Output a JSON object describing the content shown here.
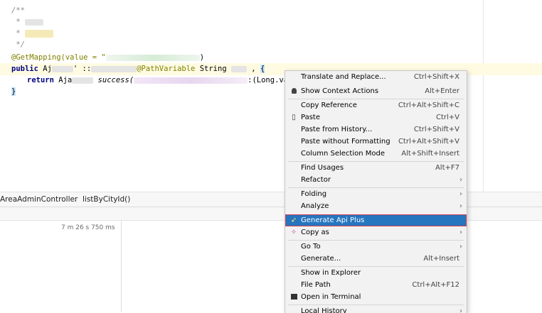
{
  "editor": {
    "comment_open": "/**",
    "comment_star1": " * ",
    "comment_star2": " * ",
    "comment_close": " */",
    "annotation_prefix": "@GetMapping(value = \"",
    "annotation_suffix": ")",
    "sig_public": "public",
    "sig_type": " Aj",
    "sig_colon": "' ::",
    "sig_pathvar": "@PathVariable",
    "sig_string": " String ",
    "sig_paren": " ,",
    "sig_brace": "{",
    "return_kw": "return",
    "return_type": " Aja",
    "return_success": " success(",
    "return_long": ":(Long.va",
    "closing_brace": "}"
  },
  "breadcrumb": {
    "class_name": "AreaAdminController",
    "separator": "›",
    "method_name": "listByCityId()"
  },
  "bottom_panel": {
    "timing": "7 m 26 s 750 ms"
  },
  "context_menu": {
    "items": [
      {
        "label": "Translate and Replace...",
        "shortcut": "Ctrl+Shift+X",
        "icon": ""
      },
      {
        "label": "Show Context Actions",
        "shortcut": "Alt+Enter",
        "icon": "lightbulb-icon"
      },
      {
        "label": "Copy Reference",
        "shortcut": "Ctrl+Alt+Shift+C",
        "icon": ""
      },
      {
        "label": "Paste",
        "shortcut": "Ctrl+V",
        "icon": "clipboard-icon"
      },
      {
        "label": "Paste from History...",
        "shortcut": "Ctrl+Shift+V",
        "icon": ""
      },
      {
        "label": "Paste without Formatting",
        "shortcut": "Ctrl+Alt+Shift+V",
        "icon": ""
      },
      {
        "label": "Column Selection Mode",
        "shortcut": "Alt+Shift+Insert",
        "icon": ""
      },
      {
        "label": "Find Usages",
        "shortcut": "Alt+F7",
        "icon": ""
      },
      {
        "label": "Refactor",
        "shortcut": "",
        "icon": "",
        "submenu": true
      },
      {
        "label": "Folding",
        "shortcut": "",
        "icon": "",
        "submenu": true
      },
      {
        "label": "Analyze",
        "shortcut": "",
        "icon": "",
        "submenu": true
      },
      {
        "label": "Generate Api Plus",
        "shortcut": "",
        "icon": "rocket-icon",
        "selected": true
      },
      {
        "label": "Copy as",
        "shortcut": "",
        "icon": "sparkle-icon",
        "submenu": true
      },
      {
        "label": "Go To",
        "shortcut": "",
        "icon": "",
        "submenu": true
      },
      {
        "label": "Generate...",
        "shortcut": "Alt+Insert",
        "icon": ""
      },
      {
        "label": "Show in Explorer",
        "shortcut": "",
        "icon": ""
      },
      {
        "label": "File Path",
        "shortcut": "Ctrl+Alt+F12",
        "icon": ""
      },
      {
        "label": "Open in Terminal",
        "shortcut": "",
        "icon": "terminal-icon"
      },
      {
        "label": "Local History",
        "shortcut": "",
        "icon": "",
        "submenu": true
      }
    ],
    "submenu_arrow": "›",
    "colors": {
      "selected_bg": "#2675bf",
      "selected_outline": "#d9454f"
    }
  }
}
